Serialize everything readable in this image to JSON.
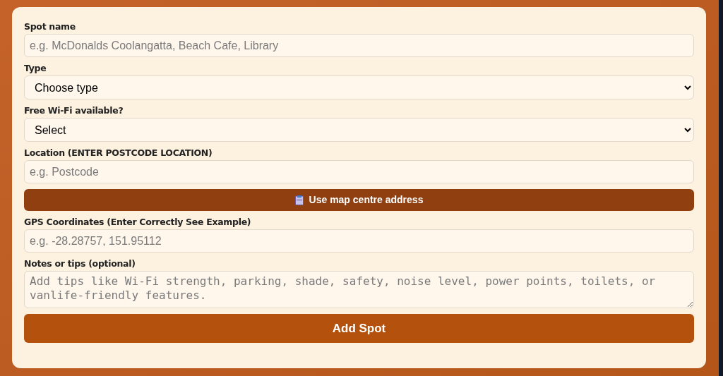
{
  "form": {
    "fields": [
      {
        "kind": "text",
        "label": "Spot name",
        "placeholder": "e.g. McDonalds Coolangatta, Beach Cafe, Library"
      },
      {
        "kind": "select",
        "label": "Type",
        "value": "Choose type"
      },
      {
        "kind": "select",
        "label": "Free Wi-Fi available?",
        "value": "Select"
      },
      {
        "kind": "text",
        "label": "Location (ENTER POSTCODE LOCATION)",
        "placeholder": "e.g. Postcode"
      },
      {
        "kind": "button",
        "label": "Use map centre address"
      },
      {
        "kind": "text",
        "label": "GPS Coordinates (Enter Correctly See Example)",
        "placeholder": "e.g. -28.28757, 151.95112"
      },
      {
        "kind": "textarea",
        "label": "Notes or tips (optional)",
        "placeholder": "Add tips like Wi-Fi strength, parking, shade, safety, noise level, power points, toilets, or vanlife-friendly features."
      },
      {
        "kind": "submit",
        "label": "Add Spot"
      }
    ]
  }
}
